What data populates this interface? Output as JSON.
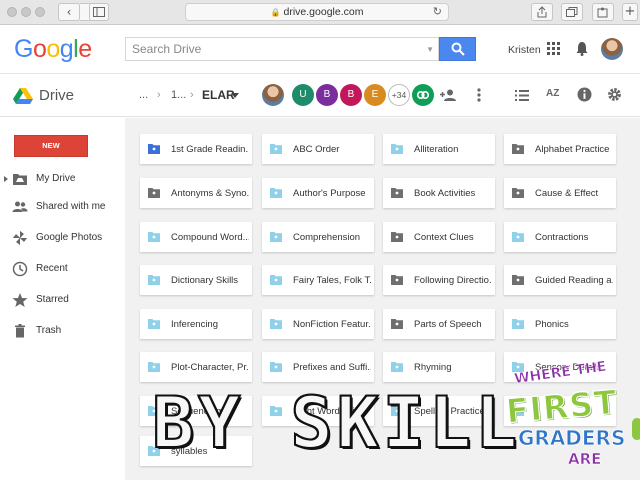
{
  "browser": {
    "url": "drive.google.com",
    "new_tab_symbol": "+"
  },
  "header": {
    "logo": "Google",
    "search_placeholder": "Search Drive",
    "user_name": "Kristen"
  },
  "drive_bar": {
    "app_name": "Drive",
    "breadcrumb": [
      "...",
      "1...",
      "ELAR"
    ],
    "collaborators": [
      {
        "initial": "U",
        "color": "#1e8c6b"
      },
      {
        "initial": "B",
        "color": "#7b2d9e"
      },
      {
        "initial": "B",
        "color": "#c2185b"
      },
      {
        "initial": "E",
        "color": "#d98b1f"
      }
    ],
    "more_collaborators": "+34",
    "az_label": "AZ"
  },
  "sidebar": {
    "new_label": "NEW",
    "items": [
      {
        "label": "My Drive",
        "icon": "drive-folder-icon"
      },
      {
        "label": "Shared with me",
        "icon": "people-icon"
      },
      {
        "label": "Google Photos",
        "icon": "pinwheel-icon"
      },
      {
        "label": "Recent",
        "icon": "clock-icon"
      },
      {
        "label": "Starred",
        "icon": "star-icon"
      },
      {
        "label": "Trash",
        "icon": "trash-icon"
      }
    ]
  },
  "folders": [
    {
      "name": "1st Grade Readin...",
      "color": "#3b6fd9"
    },
    {
      "name": "ABC Order",
      "color": "#8ed1e8"
    },
    {
      "name": "Alliteration",
      "color": "#8ed1e8"
    },
    {
      "name": "Alphabet Practice ...",
      "color": "#6f6f6f"
    },
    {
      "name": "Antonyms & Syno...",
      "color": "#6f6f6f"
    },
    {
      "name": "Author's Purpose",
      "color": "#8ed1e8"
    },
    {
      "name": "Book Activities",
      "color": "#6f6f6f"
    },
    {
      "name": "Cause & Effect",
      "color": "#6f6f6f"
    },
    {
      "name": "Compound Word...",
      "color": "#8ed1e8"
    },
    {
      "name": "Comprehension",
      "color": "#8ed1e8"
    },
    {
      "name": "Context Clues",
      "color": "#6f6f6f"
    },
    {
      "name": "Contractions",
      "color": "#8ed1e8"
    },
    {
      "name": "Dictionary Skills",
      "color": "#8ed1e8"
    },
    {
      "name": "Fairy Tales, Folk T...",
      "color": "#8ed1e8"
    },
    {
      "name": "Following Directio...",
      "color": "#6f6f6f"
    },
    {
      "name": "Guided Reading a...",
      "color": "#6f6f6f"
    },
    {
      "name": "Inferencing",
      "color": "#8ed1e8"
    },
    {
      "name": "NonFiction Featur...",
      "color": "#8ed1e8"
    },
    {
      "name": "Parts of Speech",
      "color": "#6f6f6f"
    },
    {
      "name": "Phonics",
      "color": "#8ed1e8"
    },
    {
      "name": "Plot-Character, Pr...",
      "color": "#8ed1e8"
    },
    {
      "name": "Prefixes and Suffi...",
      "color": "#8ed1e8"
    },
    {
      "name": "Rhyming",
      "color": "#8ed1e8"
    },
    {
      "name": "Sensory Details",
      "color": "#8ed1e8"
    },
    {
      "name": "Sequencing",
      "color": "#8ed1e8"
    },
    {
      "name": "Sight Word Drill",
      "color": "#8ed1e8"
    },
    {
      "name": "Spelling Practice",
      "color": "#8ed1e8"
    },
    {
      "name": "",
      "color": "#8ed1e8"
    },
    {
      "name": "syllables",
      "color": "#8ed1e8"
    }
  ],
  "overlay": {
    "title": "BY SKILL",
    "badge_where_the": "WHERE THE",
    "badge_first": "FIRST",
    "badge_graders": "GRADERS",
    "badge_are": "ARE"
  }
}
